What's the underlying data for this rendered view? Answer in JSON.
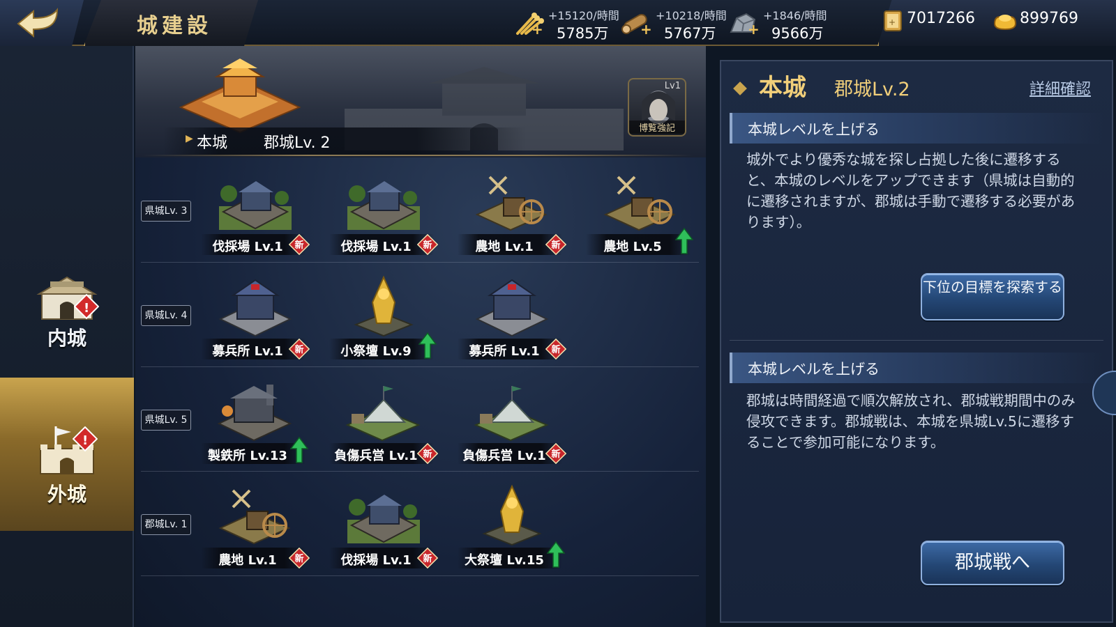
{
  "header": {
    "back_icon": "back-arrow-icon",
    "title": "城建設",
    "resources": [
      {
        "icon": "grain-icon",
        "rate": "+15120/時間",
        "amount": "5785万"
      },
      {
        "icon": "wood-log-icon",
        "rate": "+10218/時間",
        "amount": "5767万"
      },
      {
        "icon": "iron-ore-icon",
        "rate": "+1846/時間",
        "amount": "9566万"
      }
    ],
    "currencies": [
      {
        "icon": "silver-scroll-icon",
        "amount": "7017266"
      },
      {
        "icon": "gold-ingot-icon",
        "amount": "899769"
      }
    ]
  },
  "sidebar": {
    "tabs": [
      {
        "label": "内城",
        "selected": false,
        "alert": true
      },
      {
        "label": "外城",
        "selected": true,
        "alert": true
      }
    ]
  },
  "banner": {
    "name": "本城",
    "level": "郡城Lv. 2",
    "book": {
      "level": "Lv1",
      "label": "博覧強記"
    }
  },
  "rows": [
    {
      "tier": "県城Lv. 3",
      "buildings": [
        {
          "name": "伐採場 Lv.1",
          "type": "lumber",
          "badge": "new"
        },
        {
          "name": "伐採場 Lv.1",
          "type": "lumber",
          "badge": "new"
        },
        {
          "name": "農地 Lv.1",
          "type": "farm",
          "badge": "new"
        },
        {
          "name": "農地 Lv.5",
          "type": "farm",
          "badge": "up"
        }
      ]
    },
    {
      "tier": "県城Lv. 4",
      "buildings": [
        {
          "name": "募兵所 Lv.1",
          "type": "barracks",
          "badge": "new"
        },
        {
          "name": "小祭壇 Lv.9",
          "type": "altar",
          "badge": "up"
        },
        {
          "name": "募兵所 Lv.1",
          "type": "barracks",
          "badge": "new"
        }
      ]
    },
    {
      "tier": "県城Lv. 5",
      "buildings": [
        {
          "name": "製鉄所 Lv.13",
          "type": "ironworks",
          "badge": "up"
        },
        {
          "name": "負傷兵営 Lv.1",
          "type": "camp",
          "badge": "new"
        },
        {
          "name": "負傷兵営 Lv.1",
          "type": "camp",
          "badge": "new"
        }
      ]
    },
    {
      "tier": "郡城Lv. 1",
      "buildings": [
        {
          "name": "農地 Lv.1",
          "type": "farm",
          "badge": "new"
        },
        {
          "name": "伐採場 Lv.1",
          "type": "lumber",
          "badge": "new"
        },
        {
          "name": "大祭壇 Lv.15",
          "type": "altar",
          "badge": "up"
        }
      ]
    }
  ],
  "badges": {
    "new": "新"
  },
  "panel": {
    "title": "本城",
    "subtitle": "郡城Lv.2",
    "detail_link": "詳細確認",
    "sections": [
      {
        "heading": "本城レベルを上げる",
        "body": "城外でより優秀な城を探し占拠した後に遷移すると、本城のレベルをアップできます（県城は自動的に遷移されますが、郡城は手動で遷移する必要があります）。",
        "button": "下位の目標を探索する"
      },
      {
        "heading": "本城レベルを上げる",
        "body": "郡城は時間経過で順次解放され、郡城戦期間中のみ侵攻できます。郡城戦は、本城を県城Lv.5に遷移することで参加可能になります。",
        "button": "郡城戦へ"
      }
    ]
  },
  "colors": {
    "gold_text": "#f1cf7a",
    "new_badge": "#c8262b",
    "up_arrow": "#2fbf5a",
    "button_blue": "#2a4d80"
  }
}
